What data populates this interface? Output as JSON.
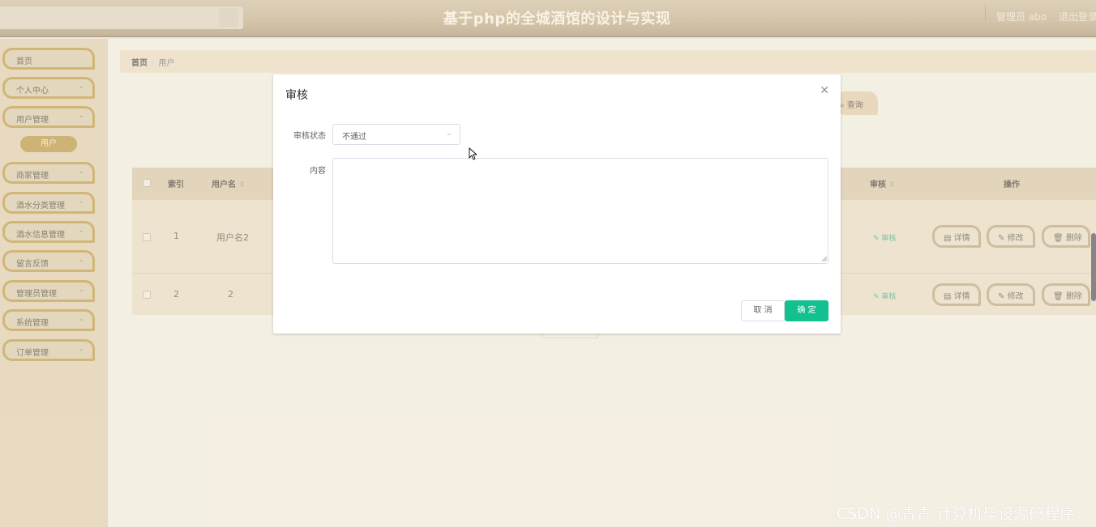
{
  "header": {
    "title": "基于php的全城酒馆的设计与实现",
    "user": "管理员 abo",
    "logout": "退出登录"
  },
  "sidebar": {
    "items": [
      {
        "label": "首页",
        "chevron": false
      },
      {
        "label": "个人中心",
        "chevron": true
      },
      {
        "label": "用户管理",
        "chevron": true
      },
      {
        "label": "商家管理",
        "chevron": true
      },
      {
        "label": "酒水分类管理",
        "chevron": true
      },
      {
        "label": "酒水信息管理",
        "chevron": true
      },
      {
        "label": "留言反馈",
        "chevron": true
      },
      {
        "label": "管理员管理",
        "chevron": true
      },
      {
        "label": "系统管理",
        "chevron": true
      },
      {
        "label": "订单管理",
        "chevron": true
      }
    ],
    "active_sub": "用户"
  },
  "breadcrumb": {
    "home": "首页",
    "sep": "/",
    "current": "用户"
  },
  "query_button": "查询",
  "table": {
    "headers": {
      "index": "索引",
      "username": "用户名",
      "audit": "审核",
      "actions": "操作"
    },
    "rows": [
      {
        "index": "1",
        "username": "用户名2",
        "audit": "审核"
      },
      {
        "index": "2",
        "username": "2",
        "audit": "审核"
      }
    ],
    "actions": {
      "detail": "详情",
      "edit": "修改",
      "delete": "删除"
    }
  },
  "dialog": {
    "title": "审核",
    "status_label": "审核状态",
    "status_value": "不通过",
    "content_label": "内容",
    "content_value": "",
    "cancel": "取 消",
    "confirm": "确 定"
  },
  "watermark": "CSDN @青青  计算机毕设源码程序"
}
